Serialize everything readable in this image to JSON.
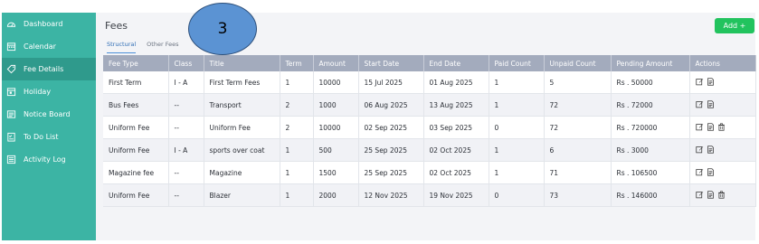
{
  "sidebar": {
    "items": [
      {
        "label": "Dashboard",
        "icon": "dashboard-icon"
      },
      {
        "label": "Calendar",
        "icon": "calendar-icon"
      },
      {
        "label": "Fee Details",
        "icon": "tag-icon",
        "active": true
      },
      {
        "label": "Holiday",
        "icon": "calendar-day-icon"
      },
      {
        "label": "Notice Board",
        "icon": "notice-board-icon"
      },
      {
        "label": "To Do List",
        "icon": "checklist-icon"
      },
      {
        "label": "Activity Log",
        "icon": "log-icon"
      }
    ]
  },
  "main": {
    "title": "Fees",
    "add_label": "Add +",
    "badge": "3",
    "tabs": [
      {
        "label": "Structural",
        "active": true
      },
      {
        "label": "Other Fees",
        "active": false
      }
    ]
  },
  "table": {
    "headers": [
      "Fee Type",
      "Class",
      "Title",
      "Term",
      "Amount",
      "Start Date",
      "End Date",
      "Paid Count",
      "Unpaid Count",
      "Pending Amount",
      "Actions"
    ],
    "rows": [
      [
        "First Term",
        "I - A",
        "First Term Fees",
        "1",
        "10000",
        "15 Jul 2025",
        "01 Aug 2025",
        "1",
        "5",
        "Rs . 50000"
      ],
      [
        "Bus Fees",
        "--",
        "Transport",
        "2",
        "1000",
        "06 Aug 2025",
        "13 Aug 2025",
        "1",
        "72",
        "Rs . 72000"
      ],
      [
        "Uniform Fee",
        "--",
        "Uniform Fee",
        "2",
        "10000",
        "02 Sep 2025",
        "03 Sep 2025",
        "0",
        "72",
        "Rs . 720000"
      ],
      [
        "Uniform Fee",
        "I - A",
        "sports over coat",
        "1",
        "500",
        "25 Sep 2025",
        "02 Oct 2025",
        "1",
        "6",
        "Rs . 3000"
      ],
      [
        "Magazine fee",
        "--",
        "Magazine",
        "1",
        "1500",
        "25 Sep 2025",
        "02 Oct 2025",
        "1",
        "71",
        "Rs . 106500"
      ],
      [
        "Uniform Fee",
        "--",
        "Blazer",
        "1",
        "2000",
        "12 Nov 2025",
        "19 Nov 2025",
        "0",
        "73",
        "Rs . 146000"
      ]
    ],
    "row_actions": [
      [
        "edit-icon",
        "receipt-icon"
      ],
      [
        "edit-icon",
        "receipt-icon"
      ],
      [
        "edit-icon",
        "receipt-icon",
        "trash-icon"
      ],
      [
        "edit-icon",
        "receipt-icon"
      ],
      [
        "edit-icon",
        "receipt-icon"
      ],
      [
        "edit-icon",
        "receipt-icon",
        "trash-icon"
      ]
    ]
  },
  "colors": {
    "sidebar": "#3cb4a4",
    "sidebar_active": "#2f9a8c",
    "add_button": "#22c35e",
    "table_header": "#a3abbd",
    "badge": "#5b93d3"
  }
}
